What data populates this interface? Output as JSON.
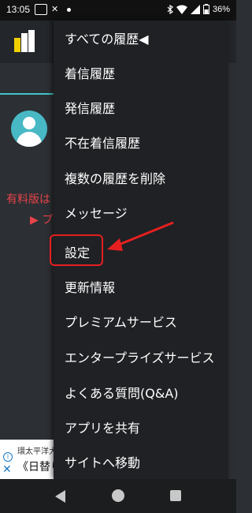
{
  "status_bar": {
    "time": "13:05",
    "battery": "36%"
  },
  "background": {
    "promo_line1": "有料版は",
    "promo_line2": "▶ プ",
    "ad_line1": "環太平洋大",
    "ad_line2": "《日替り"
  },
  "menu": {
    "items": [
      {
        "label": "すべての履歴◀"
      },
      {
        "label": "着信履歴"
      },
      {
        "label": "発信履歴"
      },
      {
        "label": "不在着信履歴"
      },
      {
        "label": "複数の履歴を削除"
      },
      {
        "label": "メッセージ"
      },
      {
        "label": "設定"
      },
      {
        "label": "更新情報"
      },
      {
        "label": "プレミアムサービス"
      },
      {
        "label": "エンタープライズサービス"
      },
      {
        "label": "よくある質問(Q&A)"
      },
      {
        "label": "アプリを共有"
      },
      {
        "label": "サイトへ移動"
      }
    ]
  },
  "colors": {
    "highlight": "#e51f1f",
    "accent": "#3fc5c8",
    "promo_text": "#e8434a"
  }
}
